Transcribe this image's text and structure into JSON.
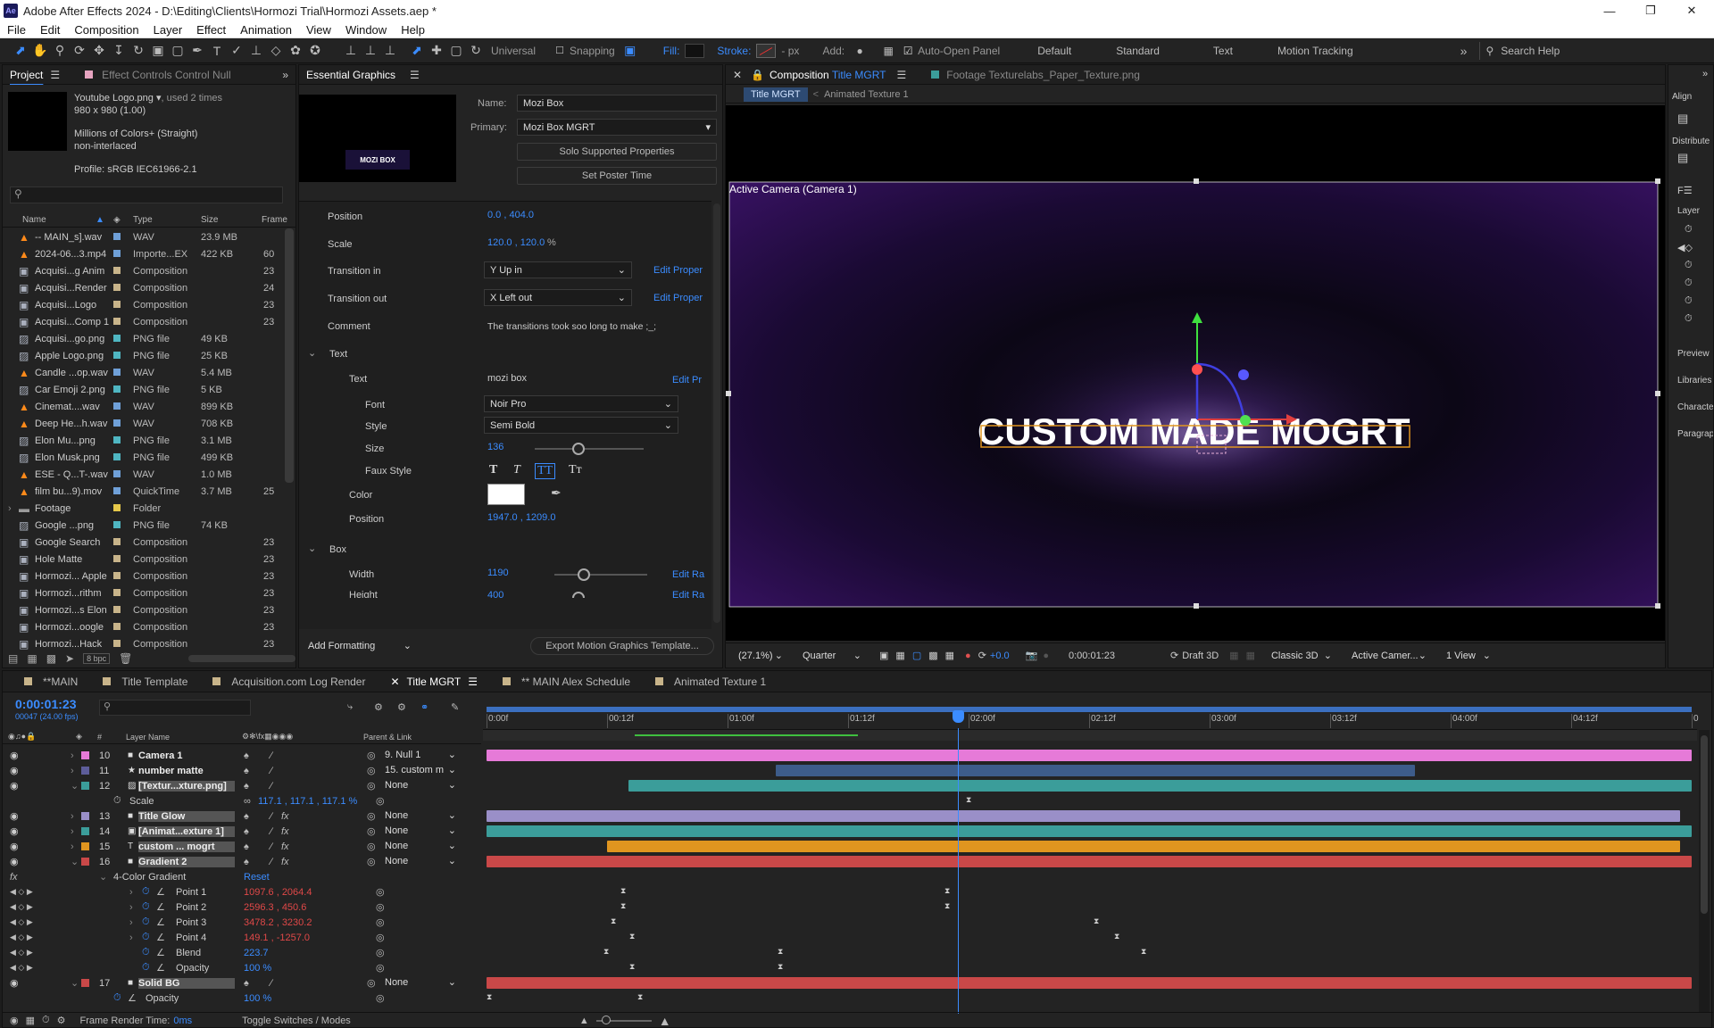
{
  "titlebar": {
    "title": "Adobe After Effects 2024 - D:\\Editing\\Clients\\Hormozi Trial\\Hormozi Assets.aep *"
  },
  "menu": [
    "File",
    "Edit",
    "Composition",
    "Layer",
    "Effect",
    "Animation",
    "View",
    "Window",
    "Help"
  ],
  "toolbar": {
    "universal": "Universal",
    "snapping": "Snapping",
    "fill": "Fill:",
    "stroke": "Stroke:",
    "px": "- px",
    "add": "Add:",
    "auto_open": "Auto-Open Panel",
    "workspaces": [
      "Default",
      "Standard",
      "Text",
      "Motion Tracking"
    ],
    "search": "Search Help"
  },
  "project": {
    "tab": "Project",
    "tab2": "Effect Controls Control Null",
    "item_name": "Youtube Logo.png",
    "used": ", used 2 times",
    "dims": "980 x 980 (1.00)",
    "colors": "Millions of Colors+ (Straight)",
    "interlace": "non-interlaced",
    "profile": "Profile: sRGB IEC61966-2.1",
    "columns": [
      "Name",
      "Type",
      "Size",
      "Frame"
    ],
    "bpc": "8 bpc",
    "items": [
      {
        "name": "-- MAIN_s].wav",
        "type": "WAV",
        "size": "23.9 MB",
        "frame": "",
        "icon": "audio",
        "color": "#6fa0d8"
      },
      {
        "name": "2024-06...3.mp4",
        "type": "Importe...EX",
        "size": "422 KB",
        "frame": "60",
        "icon": "audio",
        "color": "#6fa0d8"
      },
      {
        "name": "Acquisi...g Anim",
        "type": "Composition",
        "size": "",
        "frame": "23",
        "icon": "comp",
        "color": "#c8b48a"
      },
      {
        "name": "Acquisi...Render",
        "type": "Composition",
        "size": "",
        "frame": "24",
        "icon": "comp",
        "color": "#c8b48a"
      },
      {
        "name": "Acquisi...Logo",
        "type": "Composition",
        "size": "",
        "frame": "23",
        "icon": "comp",
        "color": "#c8b48a"
      },
      {
        "name": "Acquisi...Comp 1",
        "type": "Composition",
        "size": "",
        "frame": "23",
        "icon": "comp",
        "color": "#c8b48a"
      },
      {
        "name": "Acquisi...go.png",
        "type": "PNG file",
        "size": "49 KB",
        "frame": "",
        "icon": "img",
        "color": "#4fb6c2"
      },
      {
        "name": "Apple Logo.png",
        "type": "PNG file",
        "size": "25 KB",
        "frame": "",
        "icon": "img",
        "color": "#4fb6c2"
      },
      {
        "name": "Candle ...op.wav",
        "type": "WAV",
        "size": "5.4 MB",
        "frame": "",
        "icon": "audio",
        "color": "#6fa0d8"
      },
      {
        "name": "Car Emoji 2.png",
        "type": "PNG file",
        "size": "5 KB",
        "frame": "",
        "icon": "img",
        "color": "#4fb6c2"
      },
      {
        "name": "Cinemat....wav",
        "type": "WAV",
        "size": "899 KB",
        "frame": "",
        "icon": "audio",
        "color": "#6fa0d8"
      },
      {
        "name": "Deep He...h.wav",
        "type": "WAV",
        "size": "708 KB",
        "frame": "",
        "icon": "audio",
        "color": "#6fa0d8"
      },
      {
        "name": "Elon Mu...png",
        "type": "PNG file",
        "size": "3.1 MB",
        "frame": "",
        "icon": "img",
        "color": "#4fb6c2"
      },
      {
        "name": "Elon Musk.png",
        "type": "PNG file",
        "size": "499 KB",
        "frame": "",
        "icon": "img",
        "color": "#4fb6c2"
      },
      {
        "name": "ESE - Q...T-.wav",
        "type": "WAV",
        "size": "1.0 MB",
        "frame": "",
        "icon": "audio",
        "color": "#6fa0d8"
      },
      {
        "name": "film bu...9).mov",
        "type": "QuickTime",
        "size": "3.7 MB",
        "frame": "25",
        "icon": "audio",
        "color": "#6fa0d8"
      },
      {
        "name": "Footage",
        "type": "Folder",
        "size": "",
        "frame": "",
        "icon": "folder",
        "color": "#e6c84a"
      },
      {
        "name": "Google ...png",
        "type": "PNG file",
        "size": "74 KB",
        "frame": "",
        "icon": "img",
        "color": "#4fb6c2"
      },
      {
        "name": "Google Search",
        "type": "Composition",
        "size": "",
        "frame": "23",
        "icon": "comp",
        "color": "#c8b48a"
      },
      {
        "name": "Hole Matte",
        "type": "Composition",
        "size": "",
        "frame": "23",
        "icon": "comp",
        "color": "#c8b48a"
      },
      {
        "name": "Hormozi... Apple",
        "type": "Composition",
        "size": "",
        "frame": "23",
        "icon": "comp",
        "color": "#c8b48a"
      },
      {
        "name": "Hormozi...rithm",
        "type": "Composition",
        "size": "",
        "frame": "23",
        "icon": "comp",
        "color": "#c8b48a"
      },
      {
        "name": "Hormozi...s Elon",
        "type": "Composition",
        "size": "",
        "frame": "23",
        "icon": "comp",
        "color": "#c8b48a"
      },
      {
        "name": "Hormozi...oogle",
        "type": "Composition",
        "size": "",
        "frame": "23",
        "icon": "comp",
        "color": "#c8b48a"
      },
      {
        "name": "Hormozi...Hack",
        "type": "Composition",
        "size": "",
        "frame": "23",
        "icon": "comp",
        "color": "#c8b48a"
      }
    ]
  },
  "eg": {
    "tab": "Essential Graphics",
    "thumb_text": "MOZI BOX",
    "name_label": "Name:",
    "name_value": "Mozi Box",
    "primary_label": "Primary:",
    "primary_value": "Mozi Box MGRT",
    "solo": "Solo Supported Properties",
    "poster": "Set Poster Time",
    "position_label": "Position",
    "position_value": "0.0 , 404.0",
    "scale_label": "Scale",
    "scale_value": "120.0 , 120.0",
    "scale_unit": "%",
    "tin_label": "Transition in",
    "tin_value": "Y Up in",
    "tout_label": "Transition out",
    "tout_value": "X Left out",
    "edit_prop": "Edit Proper",
    "comment_label": "Comment",
    "comment_value": "The transitions took soo long to make ;_;",
    "text_group": "Text",
    "text_label": "Text",
    "text_value": "mozi box",
    "edit_pr": "Edit Pr",
    "font_label": "Font",
    "font_value": "Noir Pro",
    "style_label": "Style",
    "style_value": "Semi Bold",
    "size_label": "Size",
    "size_value": "136",
    "faux_label": "Faux Style",
    "faux": [
      "T",
      "T",
      "TT",
      "Tт"
    ],
    "color_label": "Color",
    "tpos_label": "Position",
    "tpos_value": "1947.0 , 1209.0",
    "box_group": "Box",
    "width_label": "Width",
    "width_value": "1190",
    "edit_ra": "Edit Ra",
    "height_label": "Height",
    "height_value": "400",
    "add_formatting": "Add Formatting",
    "export": "Export Motion Graphics Template..."
  },
  "comp": {
    "tab_label": "Composition",
    "tab_name": "Title MGRT",
    "footage_tab": "Footage Texturelabs_Paper_Texture.png",
    "crumb1": "Title MGRT",
    "crumb2": "Animated Texture 1",
    "camera_label": "Active Camera (Camera 1)",
    "canvas_text": "CUSTOM MADE MOGRT",
    "zoom": "(27.1%)",
    "res": "Quarter",
    "exposure": "+0.0",
    "time": "0:00:01:23",
    "draft": "Draft 3D",
    "renderer": "Classic 3D",
    "view_cam": "Active Camer...",
    "views": "1 View"
  },
  "right_panel": {
    "items": [
      "Align",
      "Layer",
      "Distribute",
      "Preview",
      "Libraries",
      "Character",
      "Paragraph"
    ]
  },
  "timeline": {
    "tabs": [
      "**MAIN",
      "Title Template",
      "Acquisition.com Log Render",
      "Title MGRT",
      "** MAIN Alex Schedule",
      "Animated Texture 1"
    ],
    "timecode": "0:00:01:23",
    "fps": "00047 (24.00 fps)",
    "layer_name_col": "Layer Name",
    "parent_col": "Parent & Link",
    "ruler": [
      "0:00f",
      "00:12f",
      "01:00f",
      "01:12f",
      "02:00f",
      "02:12f",
      "03:00f",
      "03:12f",
      "04:00f",
      "04:12f",
      "05:0"
    ],
    "layers": [
      {
        "num": "10",
        "name": "Camera 1",
        "parent": "9. Null 1",
        "color": "#e67ad8",
        "label": "#e67ad8",
        "bar_start": 0,
        "bar_end": 1,
        "type": "cam",
        "row": 0
      },
      {
        "num": "11",
        "name": "number matte",
        "parent": "15. custom m",
        "color": "#3d5c8a",
        "label": "#5d5d9a",
        "bar_start": 0.24,
        "bar_end": 0.77,
        "type": "star",
        "row": 1
      },
      {
        "num": "12",
        "name": "[Textur...xture.png]",
        "parent": "None",
        "color": "#3b9d9a",
        "label": "#3b9d9a",
        "bar_start": 0.118,
        "bar_end": 1,
        "type": "img",
        "row": 2
      },
      {
        "num": "13",
        "name": "Title Glow",
        "parent": "None",
        "color": "#9a8fc8",
        "label": "#9a8fc8",
        "bar_start": 0,
        "bar_end": 0.99,
        "type": "solid",
        "row": 4
      },
      {
        "num": "14",
        "name": "[Animat...exture 1]",
        "parent": "None",
        "color": "#3b9d9a",
        "label": "#3b9d9a",
        "bar_start": 0,
        "bar_end": 1,
        "type": "comp",
        "row": 5
      },
      {
        "num": "15",
        "name": "custom ... mogrt",
        "parent": "None",
        "color": "#e0951f",
        "label": "#e0951f",
        "bar_start": 0.1,
        "bar_end": 0.99,
        "type": "text",
        "row": 6
      },
      {
        "num": "16",
        "name": "Gradient 2",
        "parent": "None",
        "color": "#c94848",
        "label": "#c94848",
        "bar_start": 0,
        "bar_end": 1,
        "type": "solid",
        "row": 7
      },
      {
        "num": "17",
        "name": "Solid BG",
        "parent": "None",
        "color": "#c94848",
        "label": "#c94848",
        "bar_start": 0,
        "bar_end": 1,
        "type": "solid",
        "row": 15
      }
    ],
    "scale_row": {
      "label": "Scale",
      "value": "117.1 , 117.1 , 117.1 %"
    },
    "effect": {
      "name": "4-Color Gradient",
      "reset": "Reset"
    },
    "props": [
      {
        "name": "Point 1",
        "value": "1097.6 , 2064.4",
        "red": true,
        "row": 9
      },
      {
        "name": "Point 2",
        "value": "2596.3 , 450.6",
        "red": true,
        "row": 10
      },
      {
        "name": "Point 3",
        "value": "3478.2 , 3230.2",
        "red": true,
        "row": 11
      },
      {
        "name": "Point 4",
        "value": "149.1 , -1257.0",
        "red": true,
        "row": 12
      },
      {
        "name": "Blend",
        "value": "223.7",
        "red": false,
        "row": 13
      },
      {
        "name": "Opacity",
        "value": "100 %",
        "red": false,
        "row": 14
      }
    ],
    "solid_opacity": {
      "name": "Opacity",
      "value": "100 %"
    },
    "render_time_label": "Frame Render Time:",
    "render_time": "0ms",
    "toggle": "Toggle Switches / Modes"
  }
}
